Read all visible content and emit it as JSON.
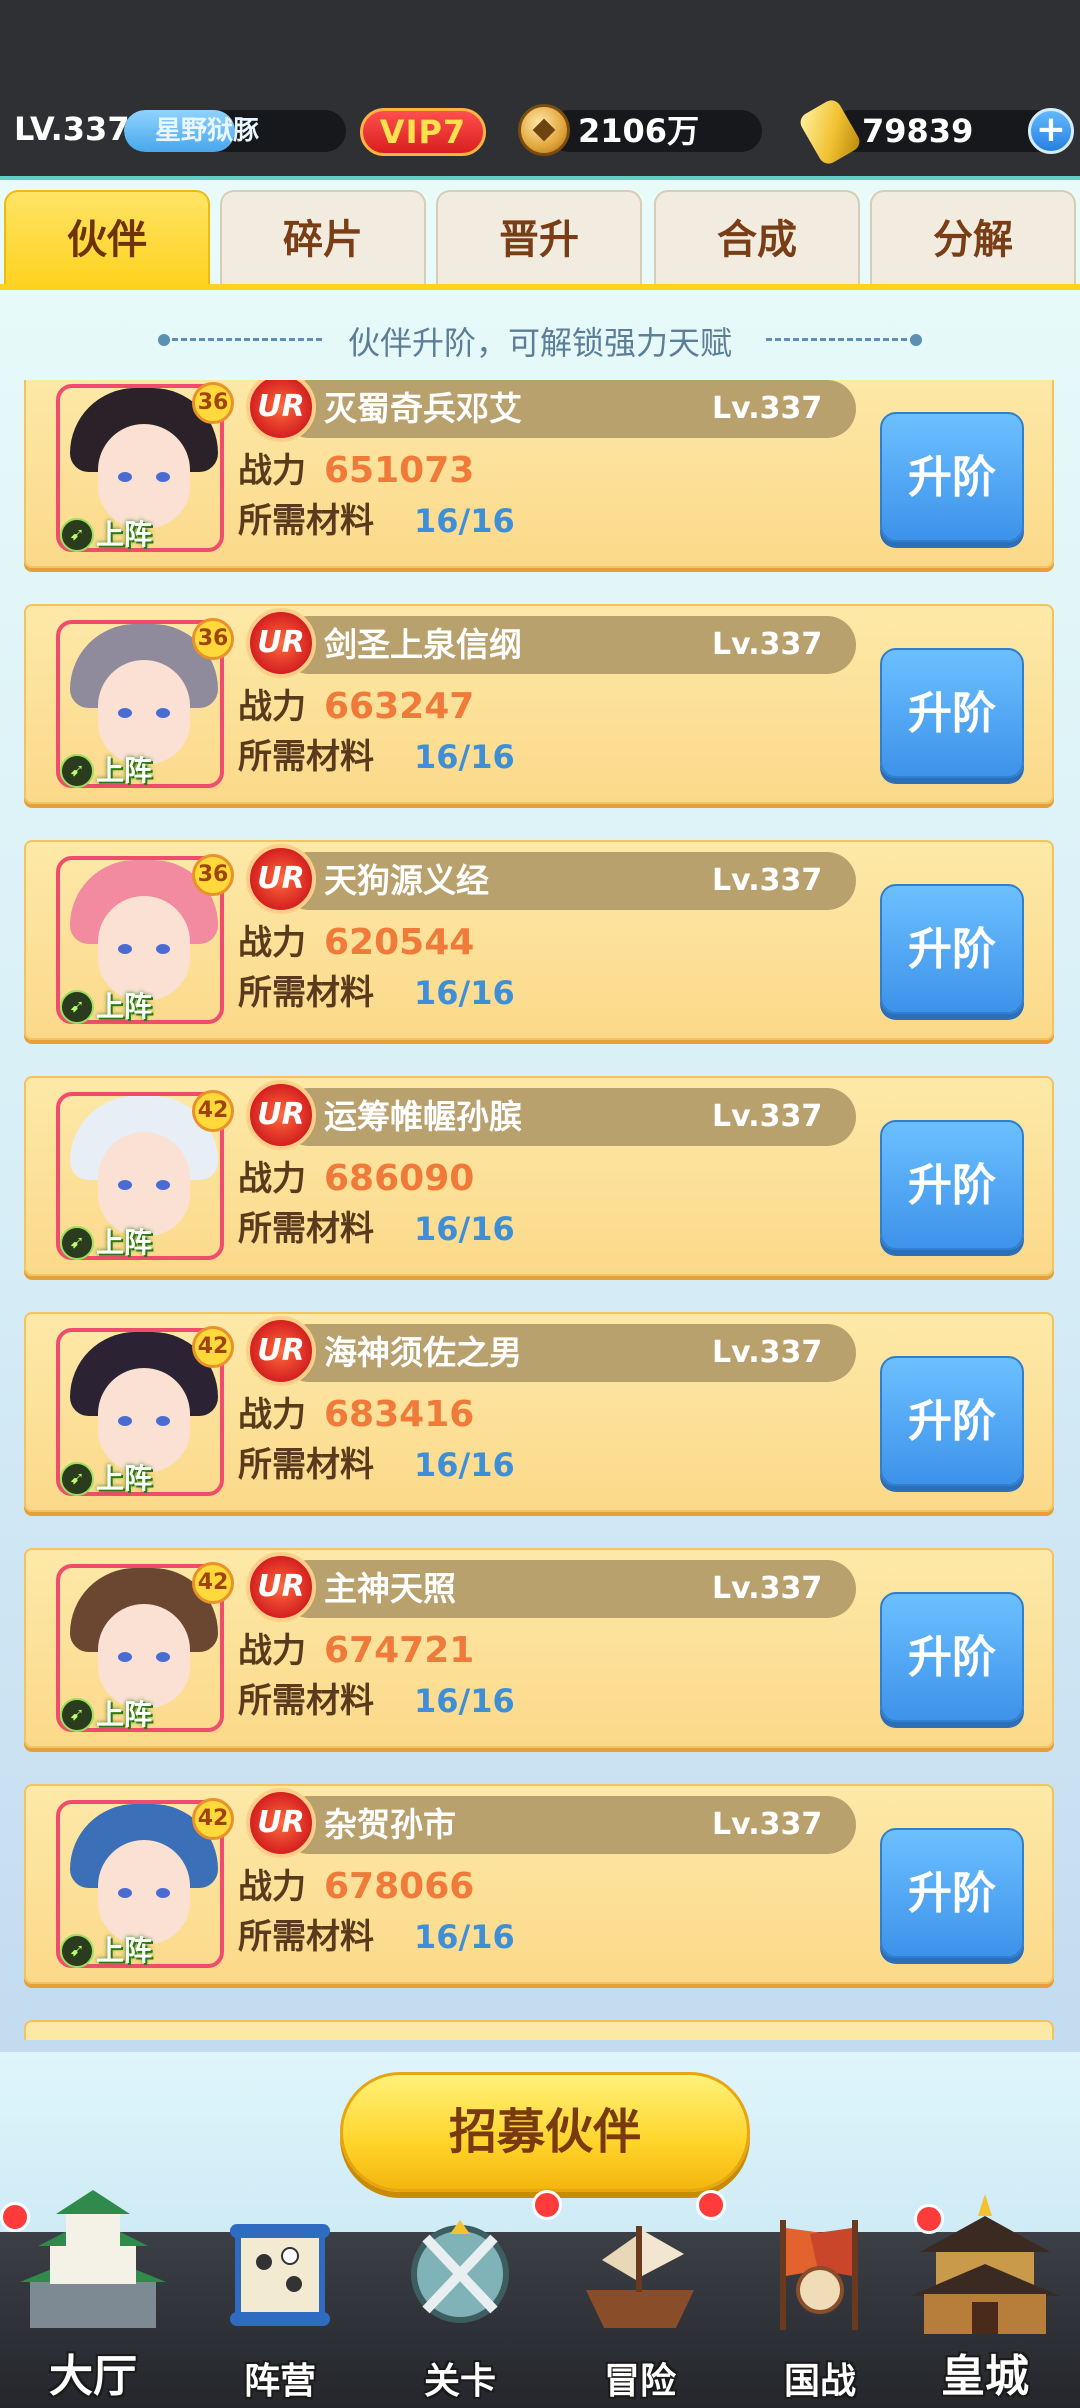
{
  "header": {
    "level": "LV.337",
    "player_name": "星野狱豚",
    "exp_fill": 0.5,
    "vip": "VIP7",
    "coins": "2106万",
    "gold": "79839",
    "plus_icon": "plus-icon",
    "coin_icon": "copper-coin-icon",
    "gold_icon": "gold-ingot-icon"
  },
  "tabs": [
    {
      "label": "伙伴",
      "active": true
    },
    {
      "label": "碎片",
      "active": false
    },
    {
      "label": "晋升",
      "active": false
    },
    {
      "label": "合成",
      "active": false
    },
    {
      "label": "分解",
      "active": false
    }
  ],
  "hint": "伙伴升阶，可解锁强力天赋",
  "card_labels": {
    "power": "战力",
    "materials": "所需材料",
    "deploy": "上阵",
    "rarity": "UR",
    "upgrade": "升阶"
  },
  "heroes": [
    {
      "name": "灭蜀奇兵邓艾",
      "lv": "Lv.337",
      "power": "651073",
      "materials": "16/16",
      "star": "36",
      "hair": "#2a2228"
    },
    {
      "name": "剑圣上泉信纲",
      "lv": "Lv.337",
      "power": "663247",
      "materials": "16/16",
      "star": "36",
      "hair": "#8f8a9c"
    },
    {
      "name": "天狗源义经",
      "lv": "Lv.337",
      "power": "620544",
      "materials": "16/16",
      "star": "36",
      "hair": "#f28aa0"
    },
    {
      "name": "运筹帷幄孙膑",
      "lv": "Lv.337",
      "power": "686090",
      "materials": "16/16",
      "star": "42",
      "hair": "#e7eef5"
    },
    {
      "name": "海神须佐之男",
      "lv": "Lv.337",
      "power": "683416",
      "materials": "16/16",
      "star": "42",
      "hair": "#2b2333"
    },
    {
      "name": "主神天照",
      "lv": "Lv.337",
      "power": "674721",
      "materials": "16/16",
      "star": "42",
      "hair": "#6b4630"
    },
    {
      "name": "杂贺孙市",
      "lv": "Lv.337",
      "power": "678066",
      "materials": "16/16",
      "star": "42",
      "hair": "#3b6fb8"
    }
  ],
  "recruit_button": "招募伙伴",
  "nav": [
    {
      "label": "大厅",
      "icon": "castle-icon",
      "badge": true
    },
    {
      "label": "阵营",
      "icon": "scroll-map-icon",
      "badge": false
    },
    {
      "label": "关卡",
      "icon": "crossed-swords-icon",
      "badge": false
    },
    {
      "label": "冒险",
      "icon": "ship-icon",
      "badge": true
    },
    {
      "label": "国战",
      "icon": "war-banner-icon",
      "badge": true
    },
    {
      "label": "皇城",
      "icon": "palace-icon",
      "badge": true
    }
  ],
  "colors": {
    "accent_yellow": "#ffd21e",
    "power_orange": "#ef7a3a",
    "material_blue": "#3f8fd6",
    "button_blue": "#3d92ea"
  }
}
